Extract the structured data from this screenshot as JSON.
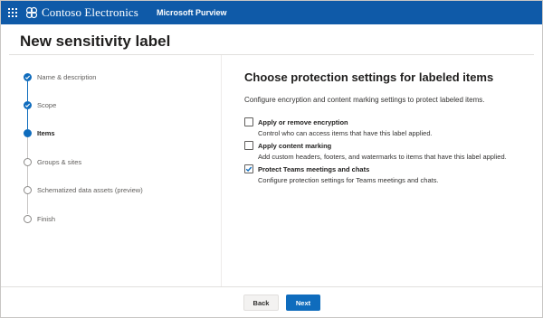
{
  "topbar": {
    "brand_name": "Contoso Electronics",
    "app_name": "Microsoft Purview",
    "waffle_icon": "app-launcher-icon",
    "logo_icon": "contoso-logo-icon",
    "background": "#0f5aa8"
  },
  "page": {
    "title": "New sensitivity label"
  },
  "steps": [
    {
      "label": "Name & description",
      "state": "done"
    },
    {
      "label": "Scope",
      "state": "done"
    },
    {
      "label": "Items",
      "state": "current"
    },
    {
      "label": "Groups & sites",
      "state": "todo"
    },
    {
      "label": "Schematized data assets (preview)",
      "state": "todo"
    },
    {
      "label": "Finish",
      "state": "todo"
    }
  ],
  "main": {
    "title": "Choose protection settings for labeled items",
    "description": "Configure encryption and content marking settings to protect labeled items.",
    "options": [
      {
        "title": "Apply or remove encryption",
        "description": "Control who can access items that have this label applied.",
        "checked": false
      },
      {
        "title": "Apply content marking",
        "description": "Add custom headers, footers, and watermarks to items that have this label applied.",
        "checked": false
      },
      {
        "title": "Protect Teams meetings and chats",
        "description": "Configure protection settings for Teams meetings and chats.",
        "checked": true
      }
    ]
  },
  "footer": {
    "back_label": "Back",
    "next_label": "Next"
  },
  "colors": {
    "accent": "#0f6cbd",
    "topbar": "#0f5aa8"
  }
}
